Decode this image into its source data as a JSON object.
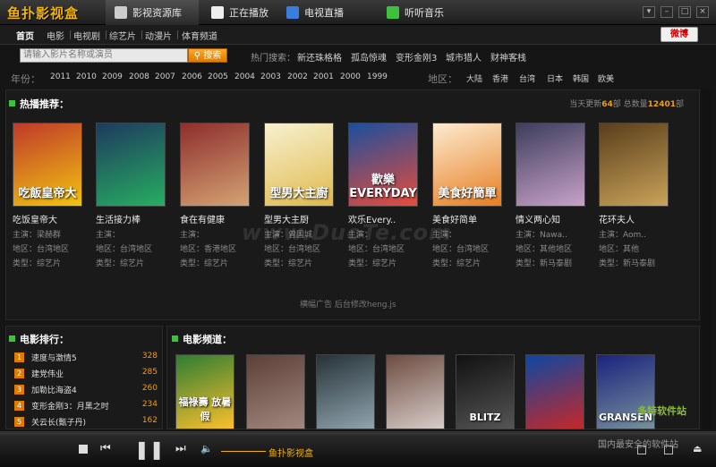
{
  "app": {
    "logo": "鱼扑影视盒"
  },
  "top_tabs": [
    {
      "label": "影视资源库",
      "active": true,
      "color": "#cfcfcf"
    },
    {
      "label": "正在播放",
      "active": false,
      "color": "#ffffff"
    },
    {
      "label": "电视直播",
      "active": false,
      "color": "#3b7ddd"
    },
    {
      "label": "听听音乐",
      "active": false,
      "color": "#3ec23e"
    }
  ],
  "nav": {
    "items": [
      "首页",
      "电影",
      "电视剧",
      "综艺片",
      "动漫片",
      "体育频道"
    ],
    "weibo": "微博"
  },
  "search": {
    "placeholder": "请输入影片名称或演员",
    "button": "搜索",
    "hot_label": "热门搜索：",
    "hot_items": [
      "新还珠格格",
      "孤岛惊魂",
      "变形金刚3",
      "城市猎人",
      "财神客栈"
    ]
  },
  "years": {
    "label": "年份：",
    "items": [
      "2011",
      "2010",
      "2009",
      "2008",
      "2007",
      "2006",
      "2005",
      "2004",
      "2003",
      "2002",
      "2001",
      "2000",
      "1999"
    ]
  },
  "regions": {
    "label": "地区：",
    "items": [
      "大陆",
      "香港",
      "台湾",
      "日本",
      "韩国",
      "欧美"
    ]
  },
  "hot": {
    "title": "热播推荐：",
    "today_label": "当天更新",
    "today_count": "64",
    "today_unit": "部",
    "total_label": "总数量",
    "total_count": "12401",
    "total_unit": "部",
    "movies": [
      {
        "name": "吃饭皇帝大",
        "star": "主演：梁赫群",
        "region": "地区：台湾地区",
        "type": "类型：综艺片",
        "poster_text": "吃飯皇帝大",
        "c1": "#c0392b",
        "c2": "#f1c40f"
      },
      {
        "name": "生活接力棒",
        "star": "主演：",
        "region": "地区：台湾地区",
        "type": "类型：综艺片",
        "poster_text": "",
        "c1": "#1e3a5f",
        "c2": "#27ae60"
      },
      {
        "name": "食在有健康",
        "star": "主演：",
        "region": "地区：香港地区",
        "type": "类型：综艺片",
        "poster_text": "",
        "c1": "#8e2e2e",
        "c2": "#d4a373"
      },
      {
        "name": "型男大主厨",
        "star": "主演：曾国城",
        "region": "地区：台湾地区",
        "type": "类型：综艺片",
        "poster_text": "型男大主廚",
        "c1": "#f7f1d0",
        "c2": "#e0b94c"
      },
      {
        "name": "欢乐Every..",
        "star": "主演：",
        "region": "地区：台湾地区",
        "type": "类型：综艺片",
        "poster_text": "歡樂EVERYDAY",
        "c1": "#1b4f9c",
        "c2": "#e74c3c"
      },
      {
        "name": "美食好简单",
        "star": "主演：",
        "region": "地区：台湾地区",
        "type": "类型：综艺片",
        "poster_text": "美食好簡單",
        "c1": "#fdebd0",
        "c2": "#e67e22"
      },
      {
        "name": "情义两心知",
        "star": "主演：Nawa..",
        "region": "地区：其他地区",
        "type": "类型：新马泰剧",
        "poster_text": "",
        "c1": "#3d3d5c",
        "c2": "#c8a2c8"
      },
      {
        "name": "花环夫人",
        "star": "主演：Aom..",
        "region": "地区：其他",
        "type": "类型：新马泰剧",
        "poster_text": "",
        "c1": "#5a3e1b",
        "c2": "#c9a35a"
      }
    ]
  },
  "banner": "横幅广告  后台修改heng.js",
  "watermark": "www.DuoTe.com",
  "ranking": {
    "title": "电影排行：",
    "items": [
      {
        "rank": "1",
        "name": "速度与激情5",
        "count": "328"
      },
      {
        "rank": "2",
        "name": "建党伟业",
        "count": "285"
      },
      {
        "rank": "3",
        "name": "加勒比海盗4",
        "count": "260"
      },
      {
        "rank": "4",
        "name": "变形金刚3：月黑之时",
        "count": "234"
      },
      {
        "rank": "5",
        "name": "关云长(甄子丹)",
        "count": "162"
      }
    ]
  },
  "channel": {
    "title": "电影频道：",
    "posters": [
      {
        "label": "福祿壽 放暑假",
        "c1": "#2e7d32",
        "c2": "#fbc02d"
      },
      {
        "label": "",
        "c1": "#5d4037",
        "c2": "#a1887f"
      },
      {
        "label": "",
        "c1": "#263238",
        "c2": "#90a4ae"
      },
      {
        "label": "",
        "c1": "#6d4c41",
        "c2": "#d7ccc8"
      },
      {
        "label": "BLITZ",
        "c1": "#111111",
        "c2": "#555555"
      },
      {
        "label": "",
        "c1": "#0d47a1",
        "c2": "#c62828"
      },
      {
        "label": "GRANSEN",
        "c1": "#1a237e",
        "c2": "#78909c"
      }
    ]
  },
  "player": {
    "now_playing": "鱼扑影视盒",
    "progress": 0.0
  },
  "footer": {
    "site": "多特软件站",
    "slogan": "国内最安全的软件站"
  }
}
